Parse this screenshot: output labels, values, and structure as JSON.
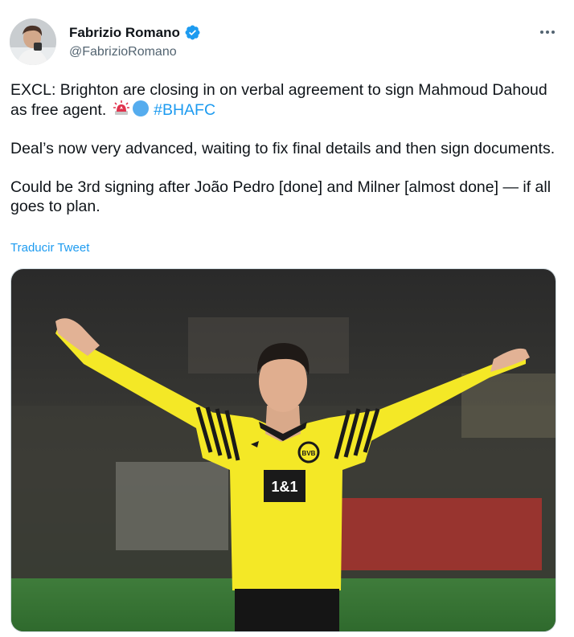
{
  "author": {
    "display_name": "Fabrizio Romano",
    "handle": "@FabrizioRomano",
    "verified": true,
    "avatar_icon": "avatar-photo"
  },
  "menu": {
    "icon": "more-options-icon"
  },
  "tweet": {
    "line1_text": "EXCL: Brighton are closing in on verbal agreement to sign Mahmoud Dahoud as free agent.",
    "emoji_1": "siren-emoji",
    "emoji_2": "blue-circle-emoji",
    "hashtag": "#BHAFC",
    "paragraph2": "Deal’s now very advanced, waiting to fix final details and then sign documents.",
    "paragraph3": "Could be 3rd signing after João Pedro [done] and Milner [almost done] — if all goes to plan."
  },
  "translate_label": "Traducir Tweet",
  "media": {
    "kit_sponsor": "1&1",
    "badge": "BVB",
    "colors": {
      "shirt": "#f4e826",
      "stripes": "#1a1a1a",
      "pitch": "#3d7a3a",
      "accent": "#1d9bf0"
    }
  }
}
